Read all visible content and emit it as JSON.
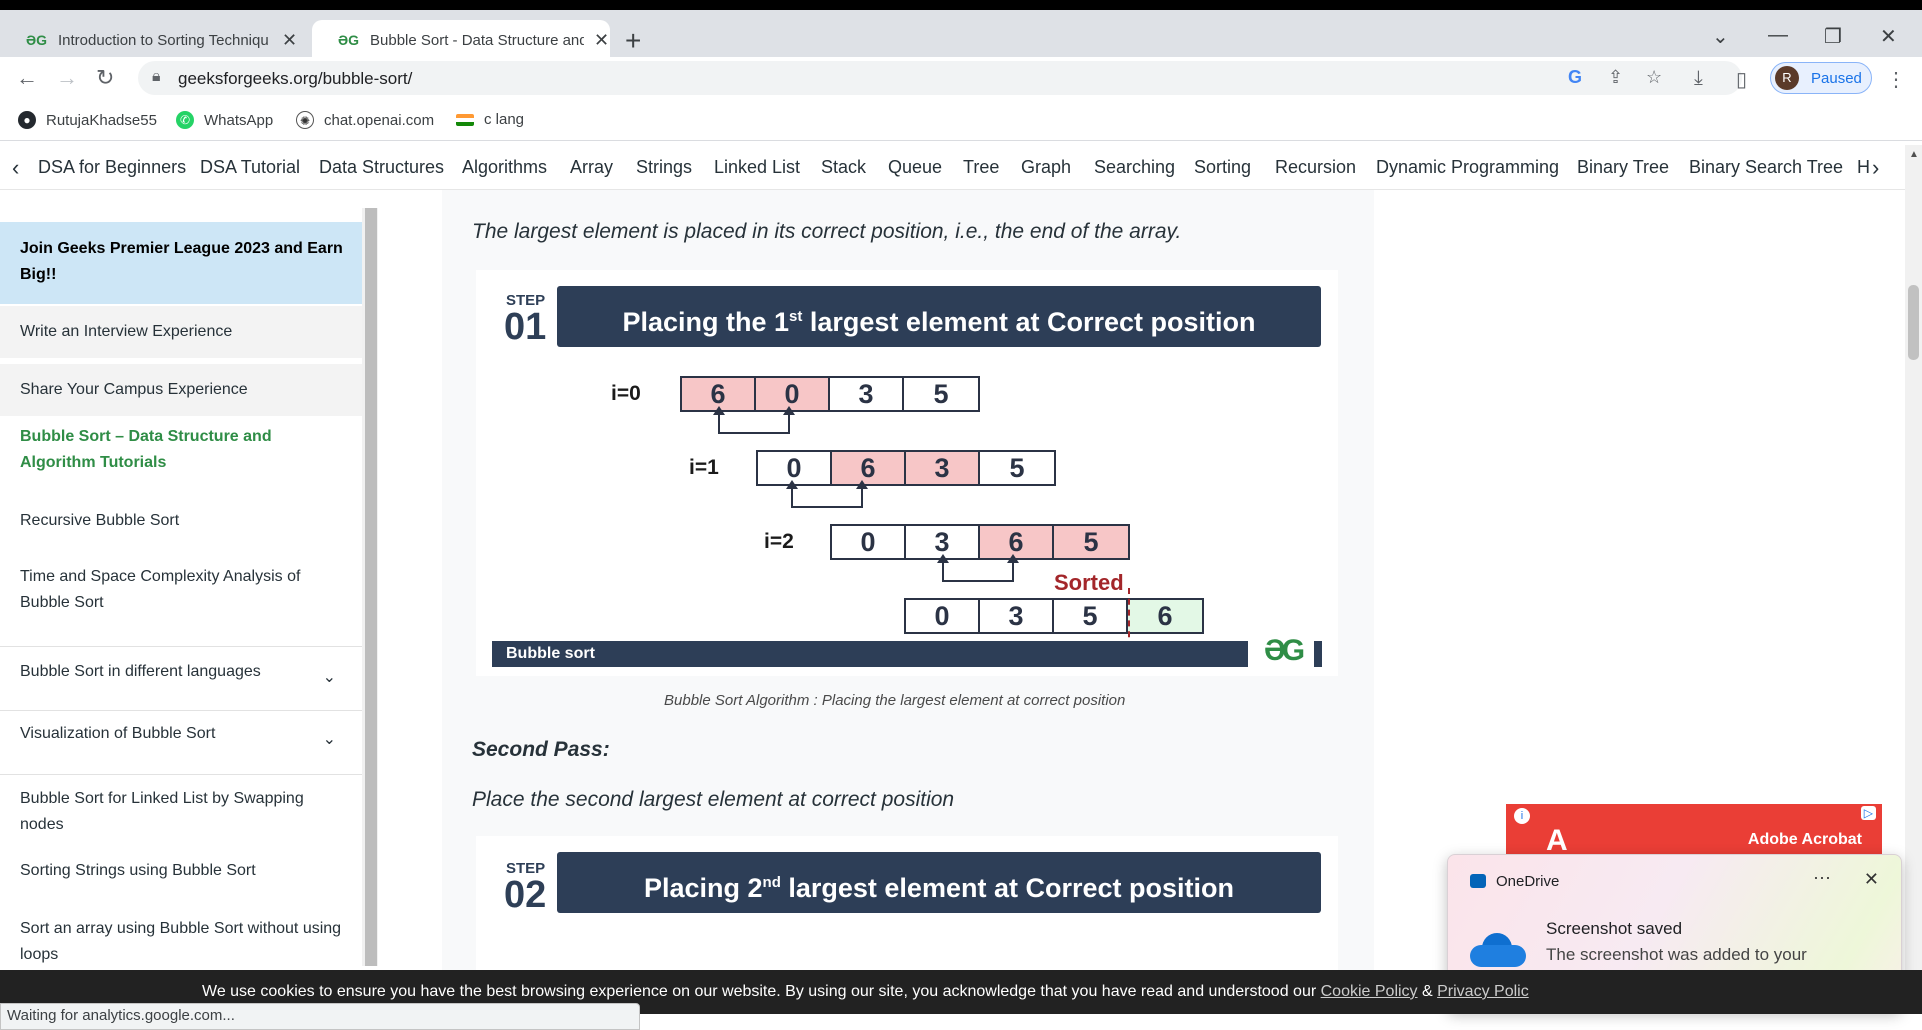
{
  "browser": {
    "tabs": [
      {
        "title": "Introduction to Sorting Techniqu",
        "active": false
      },
      {
        "title": "Bubble Sort - Data Structure and",
        "active": true
      }
    ],
    "url": "geeksforgeeks.org/bubble-sort/",
    "profile": {
      "initial": "R",
      "status": "Paused"
    },
    "bookmarks": [
      "RutujaKhadse55",
      "WhatsApp",
      "chat.openai.com",
      "c lang"
    ],
    "status_text": "Waiting for analytics.google.com..."
  },
  "gfg_nav": [
    "DSA for Beginners",
    "DSA Tutorial",
    "Data Structures",
    "Algorithms",
    "Array",
    "Strings",
    "Linked List",
    "Stack",
    "Queue",
    "Tree",
    "Graph",
    "Searching",
    "Sorting",
    "Recursion",
    "Dynamic Programming",
    "Binary Tree",
    "Binary Search Tree",
    "H"
  ],
  "sidebar": {
    "items": [
      "Join Geeks Premier League 2023 and Earn Big!!",
      "Write an Interview Experience",
      "Share Your Campus Experience",
      "Bubble Sort – Data Structure and Algorithm Tutorials",
      "Recursive Bubble Sort",
      "Time and Space Complexity Analysis of Bubble Sort",
      "Bubble Sort in different languages",
      "Visualization of Bubble Sort",
      "Bubble Sort for Linked List by Swapping nodes",
      "Sorting Strings using Bubble Sort",
      "Sort an array using Bubble Sort without using loops"
    ]
  },
  "article": {
    "intro": "The largest element is placed in its correct position, i.e., the end of the array.",
    "figure1": {
      "step_label": "STEP",
      "step_num": "01",
      "title_pre": "Placing the 1",
      "title_sup": "st",
      "title_post": " largest element at Correct position",
      "rows": [
        {
          "label": "i=0",
          "values": [
            "6",
            "0",
            "3",
            "5"
          ]
        },
        {
          "label": "i=1",
          "values": [
            "0",
            "6",
            "3",
            "5"
          ]
        },
        {
          "label": "i=2",
          "values": [
            "0",
            "3",
            "6",
            "5"
          ]
        },
        {
          "label": "",
          "values": [
            "0",
            "3",
            "5",
            "6"
          ]
        }
      ],
      "sorted_label": "Sorted",
      "footer": "Bubble sort",
      "logo": "ƏG"
    },
    "caption1": "Bubble Sort Algorithm : Placing the largest element at correct position",
    "second_pass": "Second Pass:",
    "second_text": "Place the second largest element at correct position",
    "figure2": {
      "step_label": "STEP",
      "step_num": "02",
      "title_pre": "Placing 2",
      "title_sup": "nd",
      "title_post": " largest element at Correct position"
    }
  },
  "ad": {
    "text": "Adobe Acrobat"
  },
  "toast": {
    "app": "OneDrive",
    "heading": "Screenshot saved",
    "body": "The screenshot was added to your OneDrive."
  },
  "cookie": {
    "text": "We use cookies to ensure you have the best browsing experience on our website. By using our site, you acknowledge that you have read and understood our ",
    "cookie_policy": "Cookie Policy",
    "amp": " & ",
    "privacy_policy": "Privacy Polic"
  }
}
